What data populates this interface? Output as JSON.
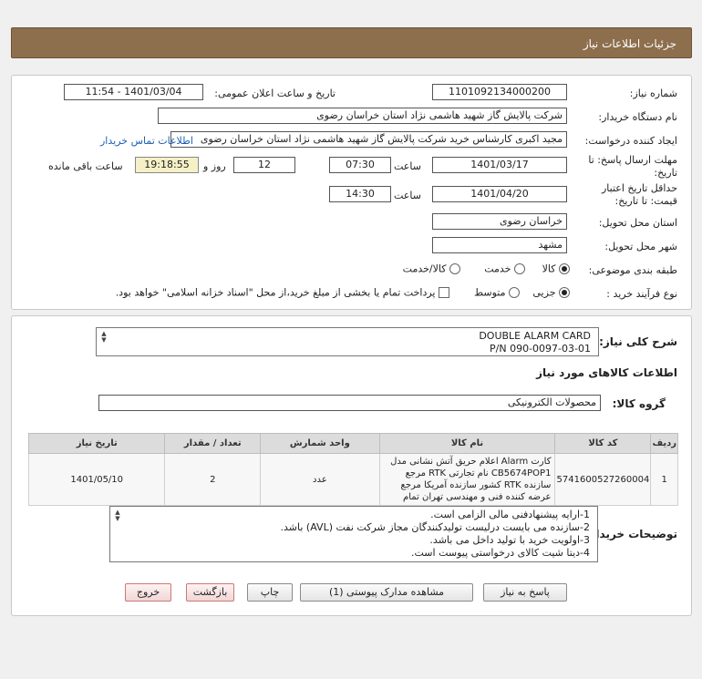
{
  "header": {
    "title": "جزئیات اطلاعات نیاز"
  },
  "form": {
    "need_number_label": "شماره نیاز:",
    "need_number": "1101092134000200",
    "announce_label": "تاریخ و ساعت اعلان عمومی:",
    "announce_value": "1401/03/04 - 11:54",
    "buyer_org_label": "نام دستگاه خریدار:",
    "buyer_org": "شرکت پالایش گاز شهید هاشمی نژاد   استان خراسان رضوی",
    "requester_label": "ایجاد کننده درخواست:",
    "requester": "مجید اکبری کارشناس خرید شرکت پالایش گاز شهید هاشمی نژاد   استان خراسان رضوی",
    "contact_link": "اطلاعات تماس خریدار",
    "deadline_label_1": "مهلت ارسال پاسخ: تا",
    "deadline_label_2": "تاریخ:",
    "deadline_date": "1401/03/17",
    "time_label": "ساعت",
    "deadline_time": "07:30",
    "days_value": "12",
    "days_label": "روز و",
    "remaining_time": "19:18:55",
    "remaining_label": "ساعت باقی مانده",
    "validity_label_1": "حداقل تاریخ اعتبار",
    "validity_label_2": "قیمت: تا تاریخ:",
    "validity_date": "1401/04/20",
    "validity_time": "14:30",
    "province_label": "استان محل تحویل:",
    "province": "خراسان رضوی",
    "city_label": "شهر محل تحویل:",
    "city": "مشهد",
    "category_label": "طبقه بندی موضوعی:",
    "category_options": [
      "کالا",
      "خدمت",
      "کالا/خدمت"
    ],
    "process_label": "نوع فرآیند خرید :",
    "process_options": [
      "جزیی",
      "متوسط"
    ],
    "payment_note": "پرداخت تمام یا بخشی از مبلغ خرید،از محل \"اسناد خزانه اسلامی\" خواهد بود."
  },
  "details": {
    "summary_label": "شرح کلی نیاز:",
    "summary_line1": "DOUBLE ALARM CARD",
    "summary_line2": "P/N 090-0097-03-01",
    "goods_info_title": "اطلاعات کالاهای مورد نیاز",
    "group_label": "گروه کالا:",
    "group_value": "محصولات الکترونیکی",
    "table": {
      "headers": [
        "ردیف",
        "کد کالا",
        "نام کالا",
        "واحد شمارش",
        "تعداد / مقدار",
        "تاریخ نیاز"
      ],
      "rows": [
        {
          "row": "1",
          "code": "5741600527260004",
          "name": "کارت Alarm اعلام حریق آتش نشانی مدل CB5674POP1 نام تجارتی RTK مرجع سازنده RTK کشور سازنده آمریکا مرجع عرضه کننده فنی و مهندسی تهران تمام",
          "unit": "عدد",
          "qty": "2",
          "date": "1401/05/10"
        }
      ]
    },
    "notes_label": "توضیحات خریدار:",
    "notes": [
      "1-ارایه پیشنهادفنی مالی الزامی است.",
      "2-سازنده می بایست درلیست تولیدکنندگان مجاز شرکت نفت (AVL)  باشد.",
      "3-اولویت خرید با  تولید داخل می باشد.",
      "4-دیتا شیت کالای درخواستی پیوست است."
    ]
  },
  "buttons": {
    "reply": "پاسخ به نیاز",
    "attachments": "مشاهده مدارک پیوستی (1)",
    "print": "چاپ",
    "back": "بازگشت",
    "exit": "خروج"
  }
}
